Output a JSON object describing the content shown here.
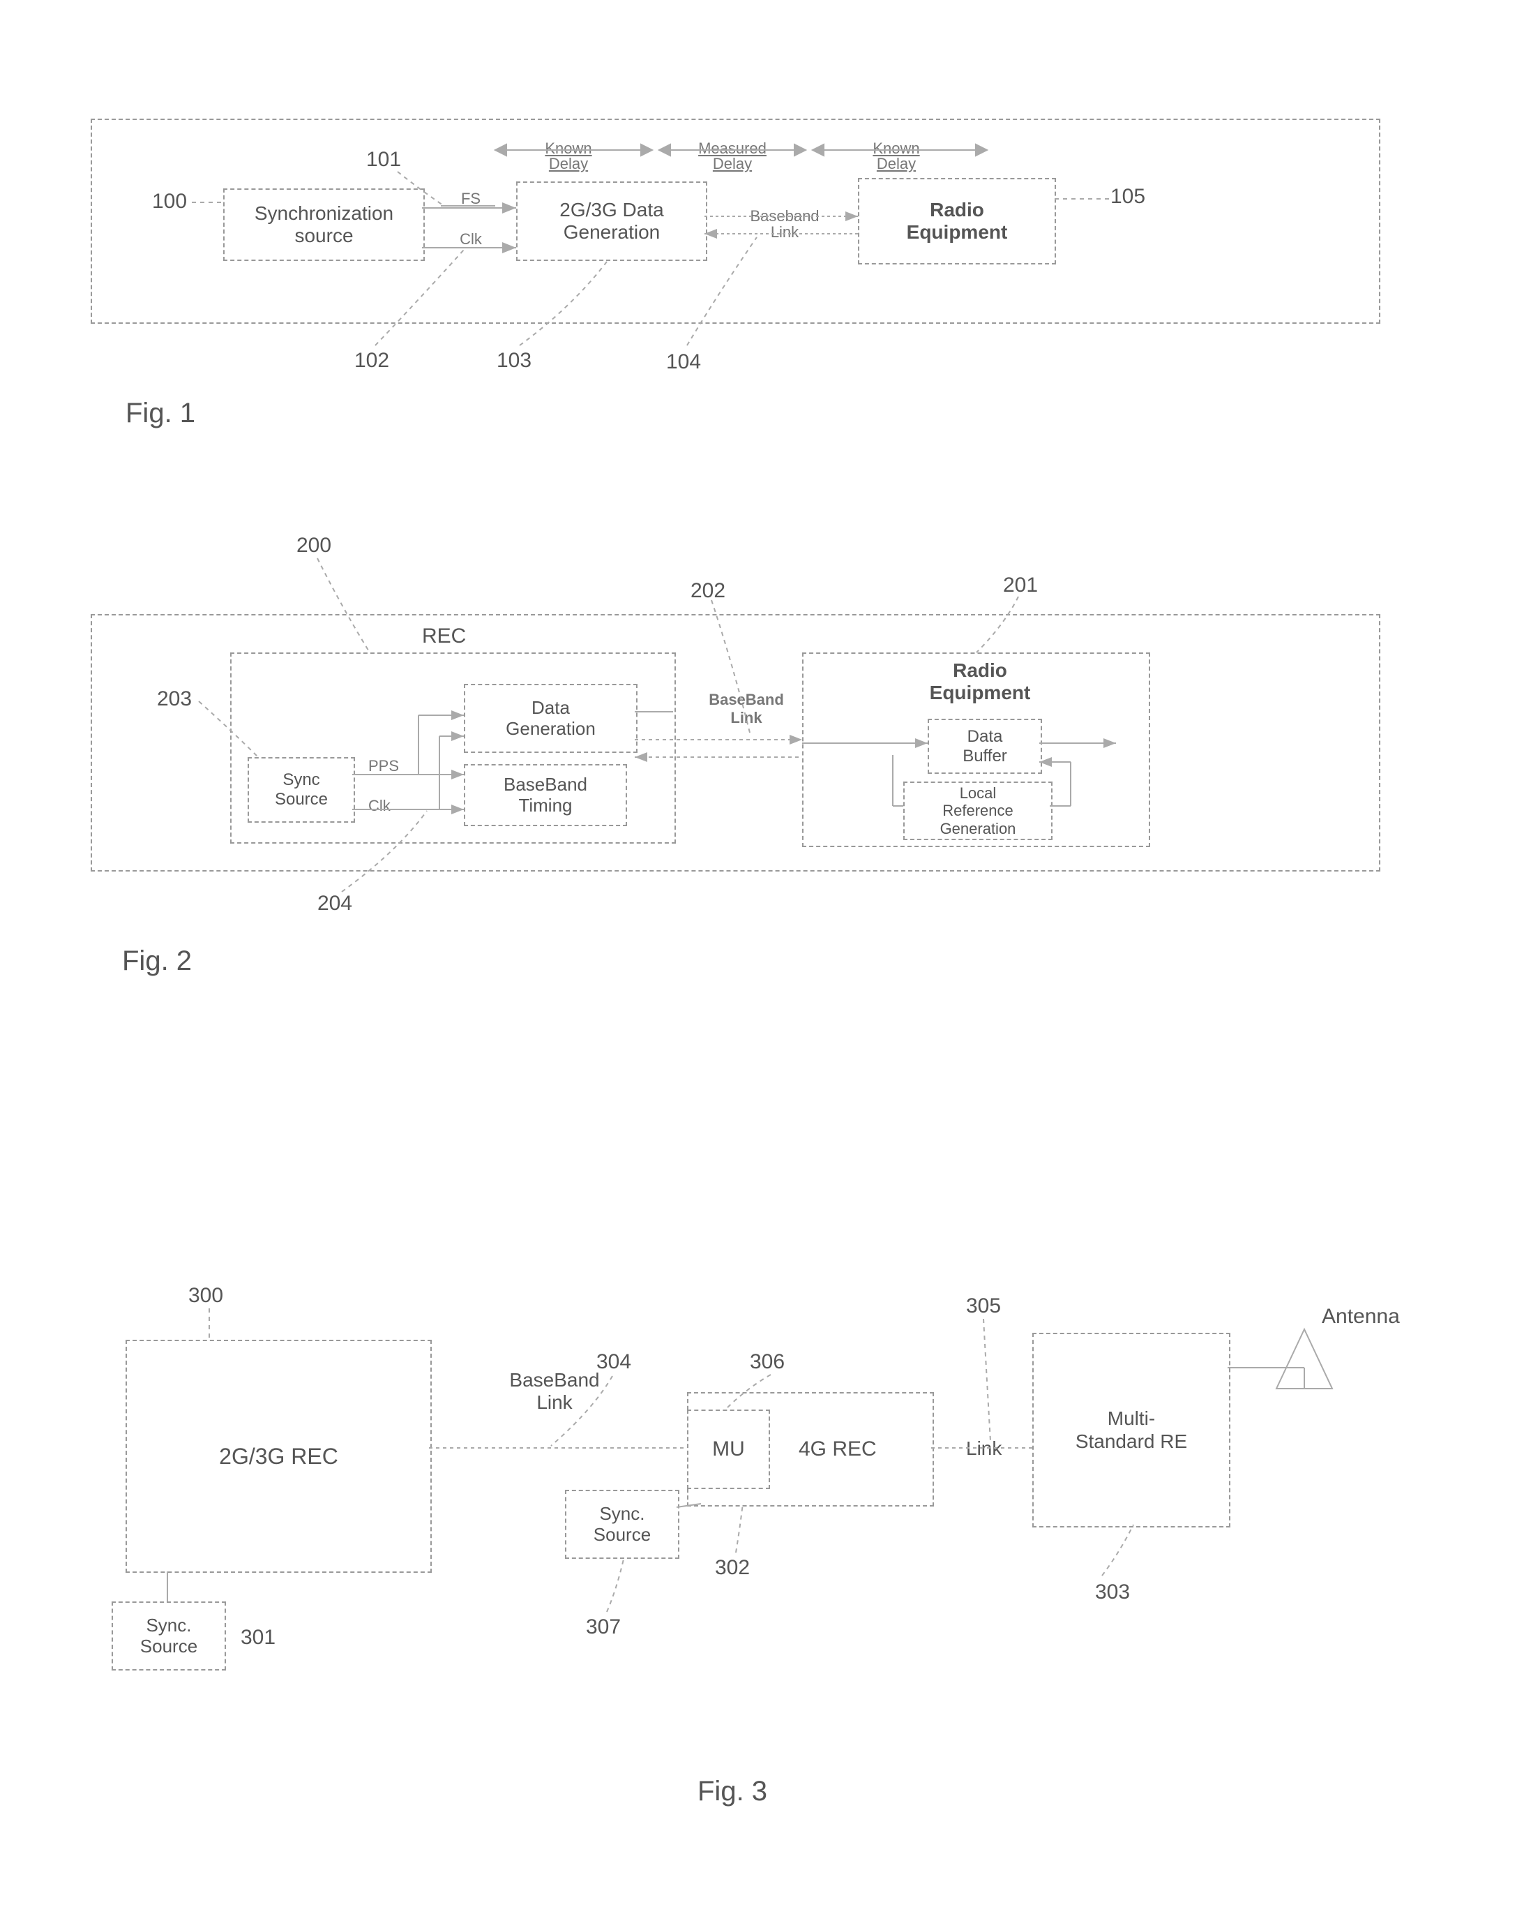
{
  "fig1": {
    "caption": "Fig. 1",
    "refs": {
      "r100": "100",
      "r101": "101",
      "r102": "102",
      "r103": "103",
      "r104": "104",
      "r105": "105"
    },
    "sync_source": "Synchronization\nsource",
    "FS": "FS",
    "Clk": "Clk",
    "data_gen": "2G/3G Data\nGeneration",
    "baseband": "Baseband\nLink",
    "radio": "Radio\nEquipment",
    "delay_known1": "Known\nDelay",
    "delay_measured": "Measured\nDelay",
    "delay_known2": "Known\nDelay"
  },
  "fig2": {
    "caption": "Fig. 2",
    "refs": {
      "r200": "200",
      "r201": "201",
      "r202": "202",
      "r203": "203",
      "r204": "204"
    },
    "rec": "REC",
    "sync_source": "Sync\nSource",
    "pps": "PPS",
    "clk": "Clk",
    "data_gen": "Data\nGeneration",
    "baseband_timing": "BaseBand\nTiming",
    "baseband_link": "BaseBand\nLink",
    "re": "Radio\nEquipment",
    "data_buffer": "Data\nBuffer",
    "local_ref": "Local\nReference\nGeneration"
  },
  "fig3": {
    "caption": "Fig. 3",
    "refs": {
      "r300": "300",
      "r301": "301",
      "r302": "302",
      "r303": "303",
      "r304": "304",
      "r305": "305",
      "r306": "306",
      "r307": "307"
    },
    "rec_2g3g": "2G/3G REC",
    "sync_source": "Sync.\nSource",
    "baseband_link": "BaseBand\nLink",
    "MU": "MU",
    "rec_4g": "4G REC",
    "Link": "Link",
    "multi_re": "Multi-\nStandard RE",
    "antenna": "Antenna"
  }
}
